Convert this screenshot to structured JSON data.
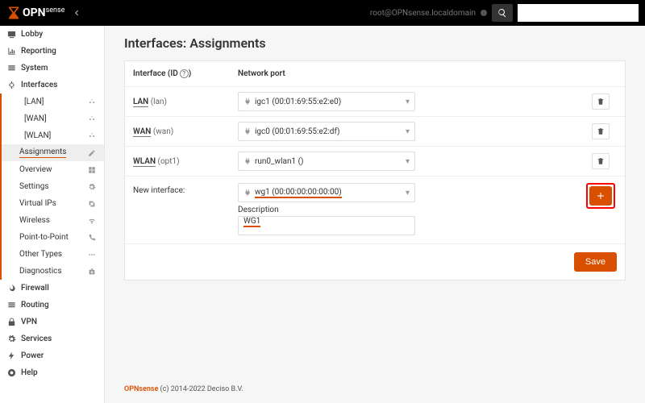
{
  "header": {
    "brand_opn": "OPN",
    "brand_sense": "sense",
    "hostname": "root@OPNsense.localdomain",
    "search_placeholder": ""
  },
  "sidebar": {
    "lobby": "Lobby",
    "reporting": "Reporting",
    "system": "System",
    "interfaces": "Interfaces",
    "if_children": {
      "lan": "[LAN]",
      "wan": "[WAN]",
      "wlan": "[WLAN]",
      "assignments": "Assignments",
      "overview": "Overview",
      "settings": "Settings",
      "virtual_ips": "Virtual IPs",
      "wireless": "Wireless",
      "ptp": "Point-to-Point",
      "other": "Other Types",
      "diagnostics": "Diagnostics"
    },
    "firewall": "Firewall",
    "routing": "Routing",
    "vpn": "VPN",
    "services": "Services",
    "power": "Power",
    "help": "Help"
  },
  "page": {
    "title": "Interfaces: Assignments",
    "col_interface": "Interface (ID",
    "col_interface_tail": ")",
    "col_port": "Network port",
    "rows": [
      {
        "name": "LAN",
        "id": "(lan)",
        "port": "igc1 (00:01:69:55:e2:e0)"
      },
      {
        "name": "WAN",
        "id": "(wan)",
        "port": "igc0 (00:01:69:55:e2:df)"
      },
      {
        "name": "WLAN",
        "id": "(opt1)",
        "port": "run0_wlan1 ()"
      }
    ],
    "new_label": "New interface:",
    "new_port": "wg1 (00:00:00:00:00:00)",
    "desc_label": "Description",
    "desc_value": "WG1",
    "save": "Save"
  },
  "footer": {
    "brand": "OPNsense",
    "text": " (c) 2014-2022 Deciso B.V."
  }
}
